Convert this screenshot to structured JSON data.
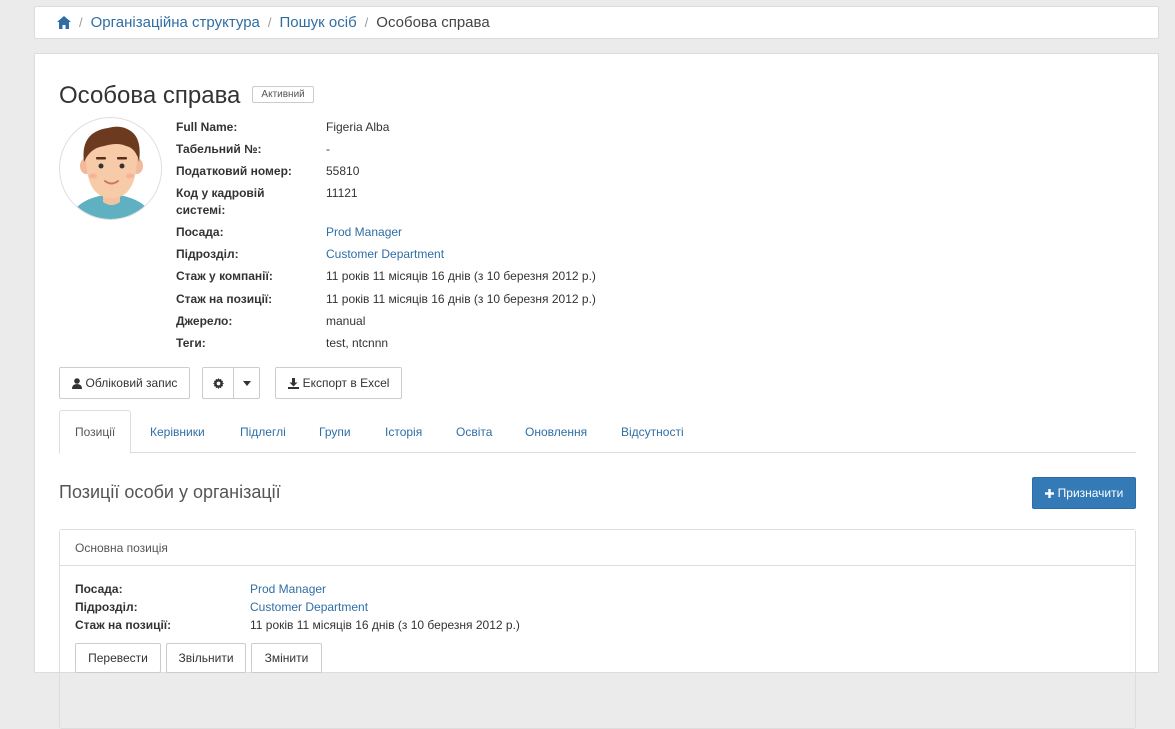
{
  "breadcrumb": {
    "items": [
      {
        "label": "Організаційна структура"
      },
      {
        "label": "Пошук осіб"
      }
    ],
    "current": "Особова справа"
  },
  "page": {
    "title": "Особова справа",
    "status_badge": "Активний"
  },
  "person": {
    "fields": [
      {
        "label": "Full Name:",
        "value": "Figeria Alba"
      },
      {
        "label": "Табельний №:",
        "value": "-"
      },
      {
        "label": "Податковий номер:",
        "value": "55810"
      },
      {
        "label": "Код у кадровій системі:",
        "value": "11121"
      },
      {
        "label": "Посада:",
        "value": "Prod Manager",
        "link": true
      },
      {
        "label": "Підрозділ:",
        "value": "Customer Department",
        "link": true
      },
      {
        "label": "Стаж у компанії:",
        "value": "11 років 11 місяців 16 днів (з 10 березня 2012 р.)"
      },
      {
        "label": "Стаж на позиції:",
        "value": "11 років 11 місяців 16 днів (з 10 березня 2012 р.)"
      },
      {
        "label": "Джерело:",
        "value": "manual"
      },
      {
        "label": "Теги:",
        "value": "test, ntcnnn"
      }
    ]
  },
  "toolbar": {
    "account_label": "Обліковий запис",
    "export_label": "Експорт в Excel"
  },
  "tabs": [
    {
      "label": "Позиції",
      "active": true
    },
    {
      "label": "Керівники"
    },
    {
      "label": "Підлеглі"
    },
    {
      "label": "Групи"
    },
    {
      "label": "Історія"
    },
    {
      "label": "Освіта"
    },
    {
      "label": "Оновлення"
    },
    {
      "label": "Відсутності"
    }
  ],
  "positions": {
    "title": "Позиції особи у організації",
    "assign_label": "Призначити",
    "main": {
      "heading": "Основна позиція",
      "fields": [
        {
          "label": "Посада:",
          "value": "Prod Manager",
          "link": true
        },
        {
          "label": "Підрозділ:",
          "value": "Customer Department",
          "link": true
        },
        {
          "label": "Стаж на позиції:",
          "value": "11 років 11 місяців 16 днів (з 10 березня 2012 р.)"
        }
      ],
      "actions": [
        "Перевести",
        "Звільнити",
        "Змінити"
      ]
    }
  },
  "colors": {
    "link": "#2f6ea5",
    "primary": "#337ab7"
  }
}
